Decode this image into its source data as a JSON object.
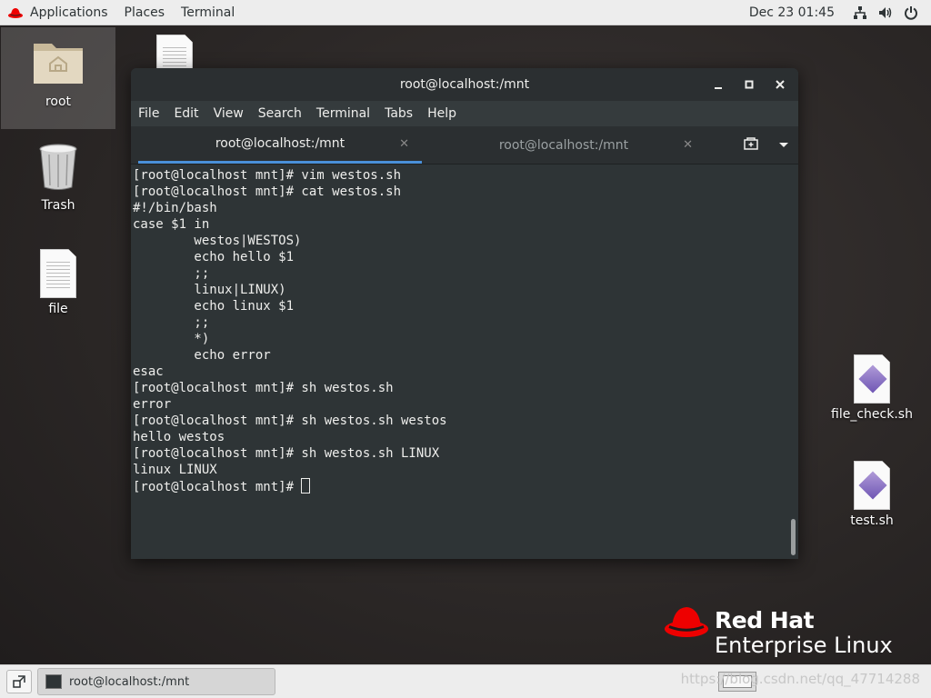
{
  "topbar": {
    "applications": "Applications",
    "places": "Places",
    "terminal": "Terminal",
    "clock": "Dec 23  01:45",
    "icons": [
      "network-icon",
      "volume-icon",
      "power-icon"
    ]
  },
  "desktop": {
    "icons": [
      {
        "name": "root",
        "type": "home-folder-icon"
      },
      {
        "name": "Trash",
        "type": "trash-icon"
      },
      {
        "name": "file",
        "type": "text-file-icon"
      },
      {
        "name": "file_check.sh",
        "type": "script-file-icon"
      },
      {
        "name": "test.sh",
        "type": "script-file-icon"
      }
    ]
  },
  "window": {
    "title": "root@localhost:/mnt",
    "menu": [
      "File",
      "Edit",
      "View",
      "Search",
      "Terminal",
      "Tabs",
      "Help"
    ],
    "tabs": [
      {
        "label": "root@localhost:/mnt",
        "active": true
      },
      {
        "label": "root@localhost:/mnt",
        "active": false
      }
    ],
    "close_glyph": "✕"
  },
  "terminal": {
    "lines": [
      "[root@localhost mnt]# vim westos.sh",
      "[root@localhost mnt]# cat westos.sh",
      "#!/bin/bash",
      "case $1 in",
      "        westos|WESTOS)",
      "        echo hello $1",
      "        ;;",
      "        linux|LINUX)",
      "        echo linux $1",
      "        ;;",
      "        *)",
      "        echo error",
      "esac",
      "[root@localhost mnt]# sh westos.sh",
      "error",
      "[root@localhost mnt]# sh westos.sh westos",
      "hello westos",
      "[root@localhost mnt]# sh westos.sh LINUX",
      "linux LINUX"
    ],
    "prompt": "[root@localhost mnt]# "
  },
  "branding": {
    "line1": "Red Hat",
    "line2": "Enterprise Linux",
    "red": "#ee0000"
  },
  "taskbar": {
    "task_label": "root@localhost:/mnt",
    "watermark": "https://blog.csdn.net/qq_47714288"
  }
}
